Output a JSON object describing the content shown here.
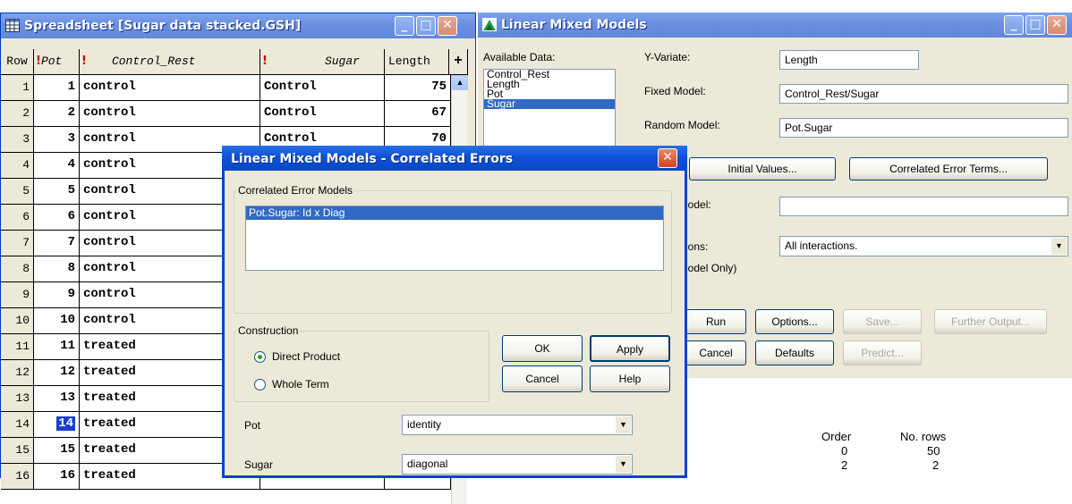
{
  "spreadsheet": {
    "title": "Spreadsheet [Sugar data stacked.GSH]",
    "headers": {
      "row": "Row",
      "pot": "Pot",
      "control_rest": "Control_Rest",
      "sugar": "Sugar",
      "length": "Length",
      "add": "+"
    },
    "rows": [
      {
        "row": "1",
        "pot": "1",
        "control_rest": "control",
        "sugar": "Control",
        "length": "75"
      },
      {
        "row": "2",
        "pot": "2",
        "control_rest": "control",
        "sugar": "Control",
        "length": "67"
      },
      {
        "row": "3",
        "pot": "3",
        "control_rest": "control",
        "sugar": "Control",
        "length": "70"
      },
      {
        "row": "4",
        "pot": "4",
        "control_rest": "control",
        "sugar": "",
        "length": ""
      },
      {
        "row": "5",
        "pot": "5",
        "control_rest": "control",
        "sugar": "",
        "length": ""
      },
      {
        "row": "6",
        "pot": "6",
        "control_rest": "control",
        "sugar": "",
        "length": ""
      },
      {
        "row": "7",
        "pot": "7",
        "control_rest": "control",
        "sugar": "",
        "length": ""
      },
      {
        "row": "8",
        "pot": "8",
        "control_rest": "control",
        "sugar": "",
        "length": ""
      },
      {
        "row": "9",
        "pot": "9",
        "control_rest": "control",
        "sugar": "",
        "length": ""
      },
      {
        "row": "10",
        "pot": "10",
        "control_rest": "control",
        "sugar": "",
        "length": ""
      },
      {
        "row": "11",
        "pot": "11",
        "control_rest": "treated",
        "sugar": "",
        "length": ""
      },
      {
        "row": "12",
        "pot": "12",
        "control_rest": "treated",
        "sugar": "",
        "length": ""
      },
      {
        "row": "13",
        "pot": "13",
        "control_rest": "treated",
        "sugar": "",
        "length": ""
      },
      {
        "row": "14",
        "pot": "14",
        "control_rest": "treated",
        "sugar": "",
        "length": ""
      },
      {
        "row": "15",
        "pot": "15",
        "control_rest": "treated",
        "sugar": "",
        "length": ""
      },
      {
        "row": "16",
        "pot": "16",
        "control_rest": "treated",
        "sugar": "",
        "length": ""
      }
    ],
    "selected_row": "14"
  },
  "lmm": {
    "title": "Linear Mixed Models",
    "available_data_label": "Available Data:",
    "available_data": [
      "Control_Rest",
      "Length",
      "Pot",
      "Sugar"
    ],
    "selected_data": "Sugar",
    "y_variate_label": "Y-Variate:",
    "y_variate": "Length",
    "fixed_model_label": "Fixed Model:",
    "fixed_model": "Control_Rest/Sugar",
    "random_model_label": "Random Model:",
    "random_model": "Pot.Sugar",
    "initial_values_btn": "Initial Values...",
    "correlated_error_btn": "Correlated Error Terms...",
    "model_label_partial": "lodel:",
    "model_value": "",
    "interactions_label_partial": "ions:",
    "interactions_value": "All interactions.",
    "model_only_partial": "lodel Only)",
    "run_btn": "Run",
    "options_btn": "Options...",
    "save_btn": "Save...",
    "further_output_btn": "Further Output...",
    "cancel_btn": "Cancel",
    "defaults_btn": "Defaults",
    "predict_btn": "Predict...",
    "output": {
      "order_header": "Order",
      "rows_header": "No. rows",
      "rows": [
        {
          "order": "0",
          "no_rows": "50"
        },
        {
          "order": "2",
          "no_rows": "2"
        }
      ]
    }
  },
  "dialog": {
    "title": "Linear Mixed Models - Correlated Errors",
    "correlated_error_models_label": "Correlated Error Models",
    "models": [
      "Pot.Sugar:  Id x Diag"
    ],
    "construction_label": "Construction",
    "direct_product": "Direct Product",
    "whole_term": "Whole Term",
    "ok_btn": "OK",
    "apply_btn": "Apply",
    "cancel_btn": "Cancel",
    "help_btn": "Help",
    "pot_label": "Pot",
    "pot_value": "identity",
    "sugar_label": "Sugar",
    "sugar_value": "diagonal"
  },
  "colors": {
    "titlebar_active": "#0c52d9",
    "selection": "#316ac5",
    "dialog_face": "#ece9d8"
  }
}
